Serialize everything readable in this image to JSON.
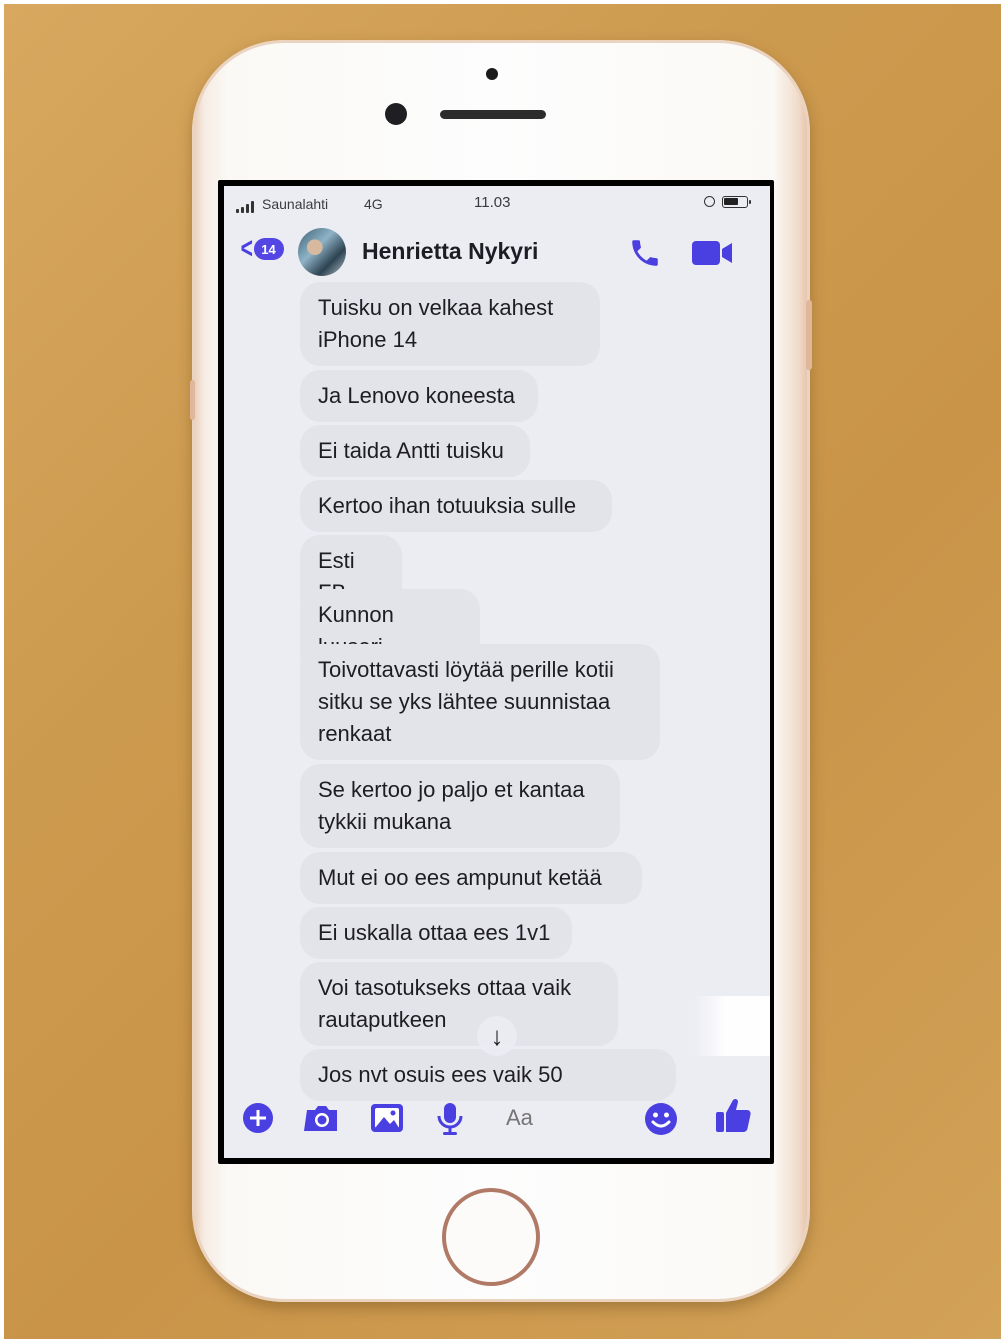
{
  "status_bar": {
    "carrier": "Saunalahti",
    "network": "4G",
    "time": "11.03"
  },
  "header": {
    "unread_count": "14",
    "contact_name": "Henrietta Nykyri",
    "icons": [
      "back-chevron-icon",
      "phone-icon",
      "video-camera-icon"
    ]
  },
  "messages": [
    {
      "text": "Tuisku on velkaa kahest iPhone 14"
    },
    {
      "text": "Ja Lenovo koneesta"
    },
    {
      "text": "Ei taida Antti tuisku"
    },
    {
      "text": "Kertoo ihan totuuksia sulle"
    },
    {
      "text": "Esti FB"
    },
    {
      "text": "Kunnon luuseri"
    },
    {
      "text": "Toivottavasti löytää perille kotii sitku se yks lähtee suunnistaa renkaat"
    },
    {
      "text": "Se kertoo jo paljo et kantaa tykkii mukana"
    },
    {
      "text": "Mut ei oo ees ampunut ketää"
    },
    {
      "text": "Ei uskalla ottaa ees 1v1"
    },
    {
      "text": "Voi tasotukseks ottaa vaik rautaputkeen"
    },
    {
      "text": "Jos nvt osuis ees vaik 50"
    }
  ],
  "composer": {
    "placeholder": "Aa",
    "icons": [
      "plus-icon",
      "camera-icon",
      "image-icon",
      "microphone-icon",
      "emoji-icon",
      "thumbs-up-icon"
    ]
  },
  "colors": {
    "accent": "#4a3fe0",
    "bubble": "#e3e3ea",
    "screen_bg": "#ececf3"
  }
}
